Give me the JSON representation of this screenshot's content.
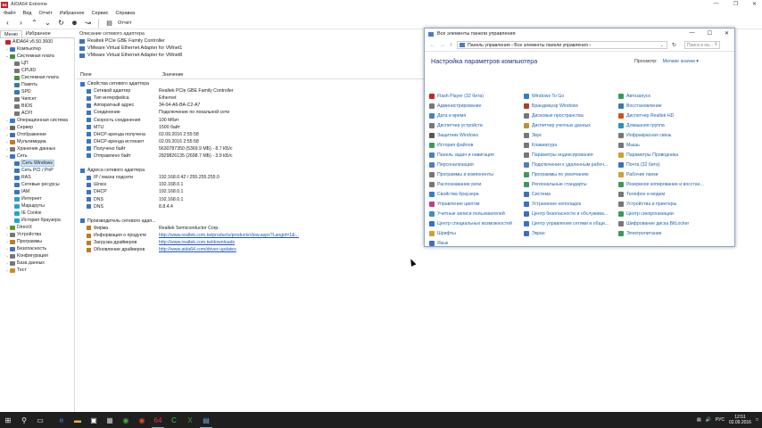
{
  "app": {
    "title": "AIDA64 Extreme",
    "icon_text": "64",
    "window_buttons": [
      "—",
      "❐",
      "✕"
    ]
  },
  "menu": [
    "Файл",
    "Вид",
    "Отчёт",
    "Избранное",
    "Сервис",
    "Справка"
  ],
  "toolbar": {
    "report_label": "Отчёт"
  },
  "left_tabs": [
    "Меню",
    "Избранное"
  ],
  "tree": [
    {
      "label": "AIDA64 v5.50.3600",
      "exp": "",
      "color": "#c8202a",
      "indent": 0
    },
    {
      "label": "Компьютер",
      "exp": "›",
      "color": "#3b74c2",
      "indent": 1
    },
    {
      "label": "Системная плата",
      "exp": "⌄",
      "color": "#4a8f3a",
      "indent": 1
    },
    {
      "label": "ЦП",
      "exp": "",
      "color": "#777",
      "indent": 2
    },
    {
      "label": "CPUID",
      "exp": "",
      "color": "#777",
      "indent": 2
    },
    {
      "label": "Системная плата",
      "exp": "",
      "color": "#4a8f3a",
      "indent": 2
    },
    {
      "label": "Память",
      "exp": "",
      "color": "#3a78a8",
      "indent": 2
    },
    {
      "label": "SPD",
      "exp": "",
      "color": "#3a78a8",
      "indent": 2
    },
    {
      "label": "Чипсет",
      "exp": "",
      "color": "#777",
      "indent": 2
    },
    {
      "label": "BIOS",
      "exp": "",
      "color": "#777",
      "indent": 2
    },
    {
      "label": "ACPI",
      "exp": "",
      "color": "#777",
      "indent": 2
    },
    {
      "label": "Операционная система",
      "exp": "›",
      "color": "#2a7fd4",
      "indent": 1
    },
    {
      "label": "Сервер",
      "exp": "›",
      "color": "#666",
      "indent": 1
    },
    {
      "label": "Отображение",
      "exp": "›",
      "color": "#4070b0",
      "indent": 1
    },
    {
      "label": "Мультимедиа",
      "exp": "›",
      "color": "#c07a20",
      "indent": 1
    },
    {
      "label": "Хранение данных",
      "exp": "›",
      "color": "#777",
      "indent": 1
    },
    {
      "label": "Сеть",
      "exp": "⌄",
      "color": "#3b74c2",
      "indent": 1
    },
    {
      "label": "Сеть Windows",
      "exp": "",
      "color": "#3b74c2",
      "indent": 2,
      "selected": true
    },
    {
      "label": "Сеть PCI / PnP",
      "exp": "",
      "color": "#3b74c2",
      "indent": 2
    },
    {
      "label": "RAS",
      "exp": "",
      "color": "#3b74c2",
      "indent": 2
    },
    {
      "label": "Сетевые ресурсы",
      "exp": "",
      "color": "#3b74c2",
      "indent": 2
    },
    {
      "label": "IAM",
      "exp": "",
      "color": "#3b74c2",
      "indent": 2
    },
    {
      "label": "Интернет",
      "exp": "",
      "color": "#2a9fd4",
      "indent": 2
    },
    {
      "label": "Маршруты",
      "exp": "",
      "color": "#2a9fd4",
      "indent": 2
    },
    {
      "label": "IE Cookie",
      "exp": "",
      "color": "#2a9fd4",
      "indent": 2
    },
    {
      "label": "История браузера",
      "exp": "",
      "color": "#2a9fd4",
      "indent": 2
    },
    {
      "label": "DirectX",
      "exp": "›",
      "color": "#5a9a2a",
      "indent": 1
    },
    {
      "label": "Устройства",
      "exp": "›",
      "color": "#777",
      "indent": 1
    },
    {
      "label": "Программы",
      "exp": "›",
      "color": "#c07a20",
      "indent": 1
    },
    {
      "label": "Безопасность",
      "exp": "›",
      "color": "#3b74c2",
      "indent": 1
    },
    {
      "label": "Конфигурация",
      "exp": "›",
      "color": "#777",
      "indent": 1
    },
    {
      "label": "База данных",
      "exp": "›",
      "color": "#777",
      "indent": 1
    },
    {
      "label": "Тест",
      "exp": "›",
      "color": "#d08a20",
      "indent": 1
    }
  ],
  "adapters": {
    "header": "Описание сетевого адаптера",
    "items": [
      "Realtek PCIe GBE Family Controller",
      "VMware Virtual Ethernet Adapter for VMnet1",
      "VMware Virtual Ethernet Adapter for VMnet8"
    ]
  },
  "columns": {
    "field": "Поле",
    "value": "Значение"
  },
  "properties": [
    {
      "type": "grp",
      "k": "Свойства сетевого адаптера",
      "color": "#3b74c2"
    },
    {
      "type": "it",
      "k": "Сетевой адаптер",
      "v": "Realtek PCIe GBE Family Controller",
      "color": "#3b74c2"
    },
    {
      "type": "it",
      "k": "Тип интерфейса",
      "v": "Ethernet",
      "color": "#3b74c2"
    },
    {
      "type": "it",
      "k": "Аппаратный адрес",
      "v": "34-04-A6-BA-C2-A7",
      "color": "#3b74c2"
    },
    {
      "type": "it",
      "k": "Соединение",
      "v": "Подключение по локальной сети",
      "color": "#3b74c2"
    },
    {
      "type": "it",
      "k": "Скорость соединения",
      "v": "100 Мбит",
      "color": "#3b74c2"
    },
    {
      "type": "it",
      "k": "MTU",
      "v": "1500 байт",
      "color": "#3b74c2"
    },
    {
      "type": "it",
      "k": "DHCP-аренда получена",
      "v": "02.09.2016 2:55:58",
      "color": "#3b74c2"
    },
    {
      "type": "it",
      "k": "DHCP-аренда истекает",
      "v": "02.09.2016 2:55:58",
      "color": "#3b74c2"
    },
    {
      "type": "it",
      "k": "Получено байт",
      "v": "5630787350 (5369.9 МБ) - 8.7 КБ/с",
      "color": "#3b74c2"
    },
    {
      "type": "it",
      "k": "Отправлено байт",
      "v": "2829826135 (2698.7 МБ) - 3.9 КБ/с",
      "color": "#3b74c2"
    },
    {
      "type": "gap"
    },
    {
      "type": "grp",
      "k": "Адреса сетевого адаптера",
      "color": "#3b74c2"
    },
    {
      "type": "it",
      "k": "IP / маска подсети",
      "v": "192.168.0.42 / 255.255.255.0",
      "color": "#3b74c2"
    },
    {
      "type": "it",
      "k": "Шлюз",
      "v": "192.168.0.1",
      "color": "#3b74c2"
    },
    {
      "type": "it",
      "k": "DHCP",
      "v": "192.168.0.1",
      "color": "#3b74c2"
    },
    {
      "type": "it",
      "k": "DNS",
      "v": "192.168.0.1",
      "color": "#3b74c2"
    },
    {
      "type": "it",
      "k": "DNS",
      "v": "8.8.4.4",
      "color": "#3b74c2"
    },
    {
      "type": "gap"
    },
    {
      "type": "grp",
      "k": "Производитель сетевого адап...",
      "color": "#3b74c2"
    },
    {
      "type": "it",
      "k": "Фирма",
      "v": "Realtek Semiconductor Corp.",
      "color": "#c07a20"
    },
    {
      "type": "it",
      "k": "Информация о продукте",
      "v": "http://www.realtek.com.tw/products/productsView.aspx?Langid=1&...",
      "color": "#c07a20",
      "link": true
    },
    {
      "type": "it",
      "k": "Загрузка драйверов",
      "v": "http://www.realtek.com.tw/downloads",
      "color": "#c07a20",
      "link": true
    },
    {
      "type": "it",
      "k": "Обновление драйверов",
      "v": "http://www.aida64.com/driver-updates",
      "color": "#c07a20",
      "link": true
    }
  ],
  "control_panel": {
    "title": "Все элементы панели управления",
    "window_buttons": [
      "—",
      "☐",
      "✕"
    ],
    "nav": [
      "←",
      "→",
      "↑"
    ],
    "breadcrumb": "Панель управления  ›  Все элементы панели управления  ›",
    "search_placeholder": "Поиск в па...",
    "heading": "Настройка параметров компьютера",
    "view_label": "Просмотр:",
    "view_value": "Мелкие значки ▾",
    "items": [
      {
        "label": "Flash Player (32 бита)",
        "color": "#c0282a"
      },
      {
        "label": "Windows To Go",
        "color": "#2a7fd4"
      },
      {
        "label": "Автозапуск",
        "color": "#3a9a5a"
      },
      {
        "label": "Администрирование",
        "color": "#777"
      },
      {
        "label": "Брандмауэр Windows",
        "color": "#b04020"
      },
      {
        "label": "Восстановление",
        "color": "#3a7ab0"
      },
      {
        "label": "Дата и время",
        "color": "#4a80c0"
      },
      {
        "label": "Дисковые пространства",
        "color": "#777"
      },
      {
        "label": "Диспетчер Realtek HD",
        "color": "#d05020"
      },
      {
        "label": "Диспетчер устройств",
        "color": "#777"
      },
      {
        "label": "Диспетчер учетных данных",
        "color": "#c09030"
      },
      {
        "label": "Домашняя группа",
        "color": "#2a90c0"
      },
      {
        "label": "Защитник Windows",
        "color": "#555"
      },
      {
        "label": "Звук",
        "color": "#777"
      },
      {
        "label": "Инфракрасная связь",
        "color": "#777"
      },
      {
        "label": "История файлов",
        "color": "#3a9a5a"
      },
      {
        "label": "Клавиатура",
        "color": "#777"
      },
      {
        "label": "Мышь",
        "color": "#777"
      },
      {
        "label": "Панель задач и навигация",
        "color": "#4a80c0"
      },
      {
        "label": "Параметры индексирования",
        "color": "#777"
      },
      {
        "label": "Параметры Проводника",
        "color": "#d0a030"
      },
      {
        "label": "Персонализация",
        "color": "#4a80c0"
      },
      {
        "label": "Подключения к удаленным рабоч...",
        "color": "#4a80c0"
      },
      {
        "label": "Почта (32 бита)",
        "color": "#3a70c0"
      },
      {
        "label": "Программы и компоненты",
        "color": "#777"
      },
      {
        "label": "Программы по умолчанию",
        "color": "#3a9a5a"
      },
      {
        "label": "Рабочие папки",
        "color": "#d0a030"
      },
      {
        "label": "Распознавание речи",
        "color": "#777"
      },
      {
        "label": "Региональные стандарты",
        "color": "#3a9a5a"
      },
      {
        "label": "Резервное копирование и восстан...",
        "color": "#3a9a5a"
      },
      {
        "label": "Свойства браузера",
        "color": "#2a7fd4"
      },
      {
        "label": "Система",
        "color": "#3a70c0"
      },
      {
        "label": "Телефон и модем",
        "color": "#777"
      },
      {
        "label": "Управление цветом",
        "color": "#c04080"
      },
      {
        "label": "Устранение неполадок",
        "color": "#3a70c0"
      },
      {
        "label": "Устройства и принтеры",
        "color": "#777"
      },
      {
        "label": "Учетные записи пользователей",
        "color": "#3a90c0"
      },
      {
        "label": "Центр безопасности и обслужива...",
        "color": "#3a70c0"
      },
      {
        "label": "Центр синхронизации",
        "color": "#3a9a5a"
      },
      {
        "label": "Центр специальных возможностей",
        "color": "#3a70c0"
      },
      {
        "label": "Центр управления сетями и общи...",
        "color": "#3a70c0"
      },
      {
        "label": "Шифрование диска BitLocker",
        "color": "#777"
      },
      {
        "label": "Шрифты",
        "color": "#d0a030"
      },
      {
        "label": "Экран",
        "color": "#3a70c0"
      },
      {
        "label": "Электропитание",
        "color": "#3a9a5a"
      },
      {
        "label": "Язык",
        "color": "#3a70c0"
      }
    ]
  },
  "taskbar": {
    "icons": [
      {
        "name": "start-icon",
        "glyph": "⊞",
        "color": "#ffffff"
      },
      {
        "name": "search-icon",
        "glyph": "⚲",
        "color": "#ffffff"
      },
      {
        "name": "task-view-icon",
        "glyph": "▭",
        "color": "#ffffff"
      },
      {
        "name": "edge-icon",
        "glyph": "e",
        "color": "#3a8fe0"
      },
      {
        "name": "file-explorer-icon",
        "glyph": "▬",
        "color": "#e8b93a"
      },
      {
        "name": "store-icon",
        "glyph": "▣",
        "color": "#ffffff"
      },
      {
        "name": "calculator-icon",
        "glyph": "▦",
        "color": "#cccccc"
      },
      {
        "name": "chrome-icon",
        "glyph": "◉",
        "color": "#4aa84a"
      },
      {
        "name": "yandex-browser-icon",
        "glyph": "◉",
        "color": "#e04a2a"
      },
      {
        "name": "aida64-icon",
        "glyph": "64",
        "color": "#e03a3a",
        "active": true
      },
      {
        "name": "camtasia-icon",
        "glyph": "C",
        "color": "#3ac05a"
      },
      {
        "name": "excel-icon",
        "glyph": "X",
        "color": "#2f9a4a"
      },
      {
        "name": "control-panel-icon",
        "glyph": "▤",
        "color": "#6aaae0",
        "active": true
      }
    ],
    "language": "РУС",
    "time": "12:51",
    "date": "02.09.2016"
  }
}
